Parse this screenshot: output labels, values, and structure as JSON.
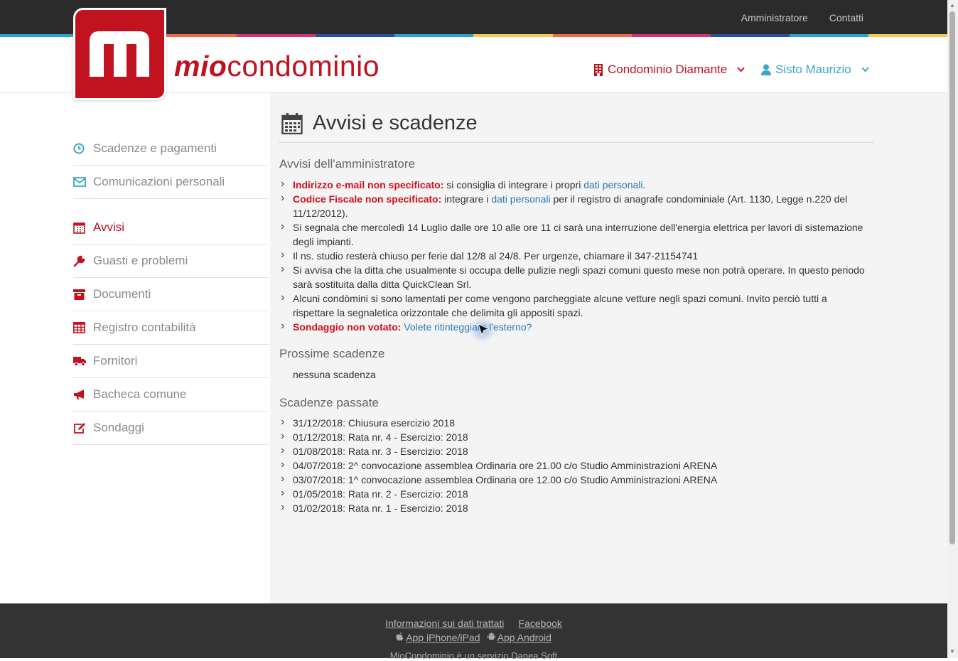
{
  "topbar": {
    "links": [
      "Amministratore",
      "Contatti"
    ]
  },
  "brand": {
    "logo_bold": "mio",
    "logo_light": "condominio",
    "color": "#c1121f"
  },
  "header": {
    "condominio": "Condominio Diamante",
    "user": "Sisto Maurizio"
  },
  "sidebar": {
    "items": [
      {
        "label": "Scadenze e pagamenti",
        "icon": "clock-icon"
      },
      {
        "label": "Comunicazioni personali",
        "icon": "envelope-icon"
      },
      {
        "label": "Avvisi",
        "icon": "calendar-icon"
      },
      {
        "label": "Guasti e problemi",
        "icon": "wrench-icon"
      },
      {
        "label": "Documenti",
        "icon": "archive-icon"
      },
      {
        "label": "Registro contabilità",
        "icon": "table-icon"
      },
      {
        "label": "Fornitori",
        "icon": "truck-icon"
      },
      {
        "label": "Bacheca comune",
        "icon": "megaphone-icon"
      },
      {
        "label": "Sondaggi",
        "icon": "edit-icon"
      }
    ]
  },
  "main": {
    "title": "Avvisi e scadenze",
    "avvisi_title": "Avvisi dell'amministratore",
    "avvisi": {
      "email_warn": "Indirizzo e-mail non specificato:",
      "email_text": " si consiglia di integrare i propri ",
      "email_link": "dati personali",
      "email_end": ".",
      "cf_warn": "Codice Fiscale non specificato:",
      "cf_text": " integrare i ",
      "cf_link": "dati personali",
      "cf_end": " per il registro di anagrafe condominiale (Art. 1130, Legge n.220 del 11/12/2012).",
      "msg1": "Si segnala che mercoledì 14 Luglio dalle ore 10 alle ore 11 ci sarà una interruzione dell'energia elettrica per lavori di sistemazione degli impianti.",
      "msg2": "Il ns. studio resterà chiuso per ferie dal 12/8 al 24/8. Per urgenze, chiamare il 347-21154741",
      "msg3": "Si avvisa che la ditta che usualmente si occupa delle pulizie negli spazi comuni questo mese non potrà operare. In questo periodo sarà sostituita dalla ditta QuickClean Srl.",
      "msg4": "Alcuni condòmini si sono lamentati per come vengono parcheggiate alcune vetture negli spazi comuni. Invito perciò tutti a rispettare la segnaletica orizzontale che delimita gli appositi spazi.",
      "poll_warn": "Sondaggio non votato:",
      "poll_link": "Volete ritinteggiare l'esterno?"
    },
    "prossime_title": "Prossime scadenze",
    "prossime_empty": "nessuna scadenza",
    "passate_title": "Scadenze passate",
    "passate": [
      "31/12/2018: Chiusura esercizio 2018",
      "01/12/2018: Rata nr. 4 - Esercizio: 2018",
      "01/08/2018: Rata nr. 3 - Esercizio: 2018",
      "04/07/2018: 2^ convocazione assemblea Ordinaria ore 21.00 c/o Studio Amministrazioni ARENA",
      "03/07/2018: 1^ convocazione assemblea Ordinaria ore 12.00 c/o Studio Amministrazioni ARENA",
      "01/05/2018: Rata nr. 2 - Esercizio: 2018",
      "01/02/2018: Rata nr. 1 - Esercizio: 2018"
    ]
  },
  "footer": {
    "info": "Informazioni sui dati trattati",
    "facebook": "Facebook",
    "iphone": "App iPhone/iPad",
    "android": "App Android",
    "service": "MioCondominio è un servizio Danea Soft"
  }
}
